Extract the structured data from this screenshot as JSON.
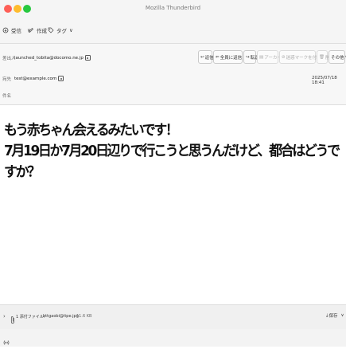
{
  "window": {
    "title": "Mozilla Thunderbird",
    "traffic_colors": [
      "#fe5f57",
      "#febc2e",
      "#28c840"
    ]
  },
  "toolbar": {
    "get_messages": "受信",
    "write": "作成",
    "tag": "タグ"
  },
  "header": {
    "from_label": "差出人",
    "from_value": "launched_tobita@docomo.ne.jp",
    "to_label": "宛先",
    "to_value": "test@example.com",
    "subject_label": "件名",
    "subject_value": "",
    "date": "2025/07/18 18:41"
  },
  "actions": {
    "reply": "返信",
    "reply_all": "全員に返信",
    "forward": "転送",
    "archive": "アーカイブ",
    "junk": "迷惑マークを付ける",
    "delete": "削除",
    "other": "その他"
  },
  "body": {
    "line1": "もう赤ちゃん会えるみたいです！",
    "line2": "7月19日か7月20日辺りで行こうと思うんだけど、都合はどうですか？"
  },
  "attachment": {
    "count_label": "1 添付ファイル:",
    "filename": "bttgaobi@itpe.jpg",
    "size": "11.6 KB",
    "save": "保存"
  }
}
